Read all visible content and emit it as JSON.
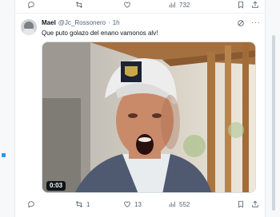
{
  "previous_tweet": {
    "actions": {
      "reply_count": "",
      "retweet_count": "",
      "like_count": "",
      "views_count": "732"
    }
  },
  "tweet": {
    "author_name": "Mael",
    "author_handle": "@Jc_Rossonero",
    "separator": "·",
    "time": "1h",
    "text": "Que puto golazo del enano vamonos alv!",
    "video_duration": "0:03",
    "actions": {
      "reply_count": "",
      "retweet_count": "1",
      "like_count": "13",
      "views_count": "552"
    }
  },
  "colors": {
    "accent": "#1d9bf0",
    "text": "#0f1419",
    "muted": "#536471"
  }
}
